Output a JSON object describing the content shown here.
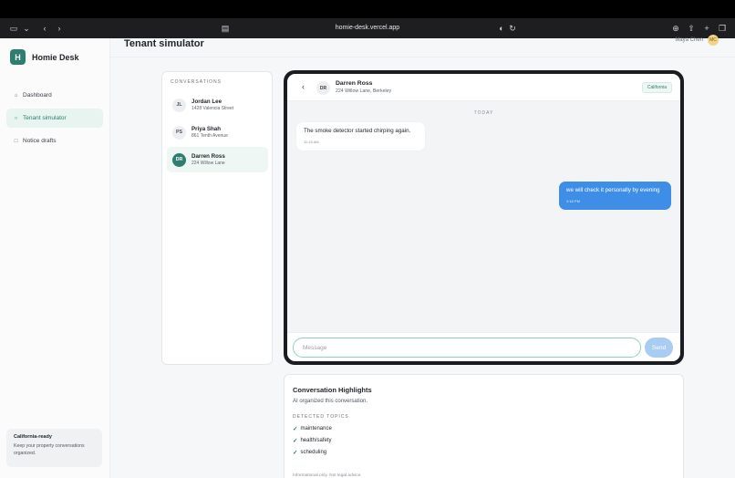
{
  "browser": {
    "url": "homie-desk.vercel.app"
  },
  "app": {
    "logo_letter": "H",
    "name": "Homie Desk"
  },
  "sidebar": {
    "items": [
      {
        "icon": "home-icon",
        "label": "Dashboard"
      },
      {
        "icon": "circle-icon",
        "label": "Tenant simulator",
        "active": true
      },
      {
        "icon": "document-icon",
        "label": "Notice drafts"
      }
    ],
    "promo": {
      "title": "California-ready",
      "text": "Keep your property conversations organized."
    }
  },
  "header": {
    "title": "Tenant simulator",
    "user_name": "Maya Chen",
    "user_initials": "MC"
  },
  "conversations": {
    "heading": "CONVERSATIONS",
    "items": [
      {
        "initials": "JL",
        "name": "Jordan Lee",
        "address": "1428 Valencia Street"
      },
      {
        "initials": "PS",
        "name": "Priya Shah",
        "address": "861 Tenth Avenue"
      },
      {
        "initials": "DR",
        "name": "Darren Ross",
        "address": "224 Willow Lane",
        "active": true
      }
    ]
  },
  "chat": {
    "contact": {
      "initials": "DR",
      "name": "Darren Ross",
      "address": "224 Willow Lane, Berkeley"
    },
    "state_badge": "California",
    "day_label": "TODAY",
    "messages": [
      {
        "direction": "in",
        "text": "The smoke detector started chirping again.",
        "time": "11:15 AM"
      },
      {
        "direction": "out",
        "text": "we will check it personally by evening",
        "time": "3:18 PM"
      }
    ],
    "input_placeholder": "Message",
    "send_label": "Send"
  },
  "highlights": {
    "title": "Conversation Highlights",
    "subtitle": "AI organized this conversation.",
    "topics_heading": "DETECTED TOPICS",
    "topics": [
      "maintenance",
      "health/safety",
      "scheduling"
    ],
    "footer": "Informational only. Not legal advice."
  },
  "colors": {
    "accent": "#2f7d6f",
    "bubble_out": "#3e8ee8",
    "send_disabled": "#a9ccf2"
  }
}
